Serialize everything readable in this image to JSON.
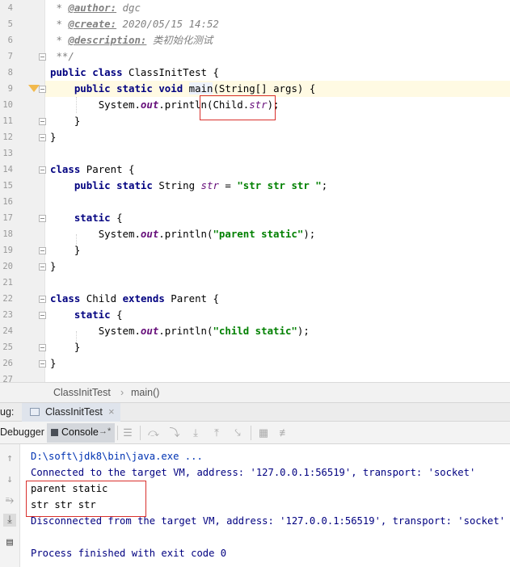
{
  "editor": {
    "line_numbers": [
      "4",
      "5",
      "6",
      "7",
      "8",
      "9",
      "10",
      "11",
      "12",
      "13",
      "14",
      "15",
      "16",
      "17",
      "18",
      "19",
      "20",
      "21",
      "22",
      "23",
      "24",
      "25",
      "26",
      "27"
    ],
    "comments": {
      "author_tag": "@author:",
      "author_value": " dgc",
      "create_tag": "@create:",
      "create_value": " 2020/05/15 14:52",
      "description_tag": "@description:",
      "description_value": " 类初始化测试",
      "star": " * ",
      "end": " **/"
    },
    "kw": {
      "public": "public",
      "class": "class",
      "static": "static",
      "void": "void",
      "extends": "extends"
    },
    "idents": {
      "class_init_test": "ClassInitTest",
      "main": "main",
      "main_args": "(String[] args) {",
      "system": "System.",
      "out": "out",
      "println": ".println(",
      "child_ref": "Child.",
      "str_field": "str",
      "call_end": ");",
      "brace_open": " {",
      "brace_close": "}",
      "parent": "Parent",
      "child": "Child",
      "string_type": "String",
      "assign": " = ",
      "semicolon": ";"
    },
    "strings": {
      "str_value": "\"str str str \"",
      "parent_static": "\"parent static\"",
      "child_static": "\"child static\""
    }
  },
  "breadcrumb": {
    "class": "ClassInitTest",
    "sep": "›",
    "method": "main()"
  },
  "debug": {
    "panel_label": "ug:",
    "tab_label": "ClassInitTest",
    "close": "×",
    "debugger_tab": "Debugger",
    "console_tab": "Console",
    "console_pin": "→*"
  },
  "console": {
    "command": "D:\\soft\\jdk8\\bin\\java.exe ...",
    "connected": "Connected to the target VM, address: '127.0.0.1:56519', transport: 'socket'",
    "output": [
      "parent static",
      "str str str"
    ],
    "disconnected": "Disconnected from the target VM, address: '127.0.0.1:56519', transport: 'socket'",
    "exit": "Process finished with exit code 0"
  },
  "colors": {
    "keyword": "#000080",
    "string": "#008000",
    "field": "#660e7a",
    "highlight_box": "#d9302c",
    "caret_row": "#fffae3"
  }
}
